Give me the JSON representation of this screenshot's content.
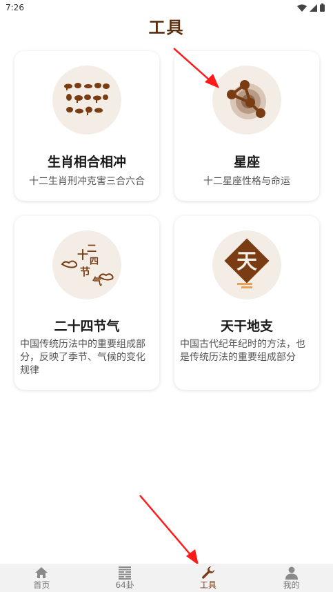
{
  "status": {
    "time": "7:26"
  },
  "header": {
    "title": "工具"
  },
  "cards": [
    {
      "title": "生肖相合相冲",
      "desc": "十二生肖刑冲克害三合六合"
    },
    {
      "title": "星座",
      "desc": "十二星座性格与命运"
    },
    {
      "title": "二十四节气",
      "desc": "中国传统历法中的重要组成部分，反映了季节、气候的变化规律",
      "icon_text": [
        "二",
        "十",
        "四",
        "节",
        "气"
      ]
    },
    {
      "title": "天干地支",
      "desc": "中国古代纪年纪时的方法，也是传统历法的重要组成部分",
      "icon_text": "天"
    }
  ],
  "tabs": [
    {
      "label": "首页",
      "icon": "home-icon"
    },
    {
      "label": "64卦",
      "icon": "hexagram-icon"
    },
    {
      "label": "工具",
      "icon": "wrench-icon"
    },
    {
      "label": "我的",
      "icon": "person-icon"
    }
  ],
  "active_tab": "工具",
  "colors": {
    "accent": "#7a3c12",
    "title": "#5a2d0f",
    "icon_bg": "#f4ede6",
    "arrow": "#ff1a1a"
  }
}
